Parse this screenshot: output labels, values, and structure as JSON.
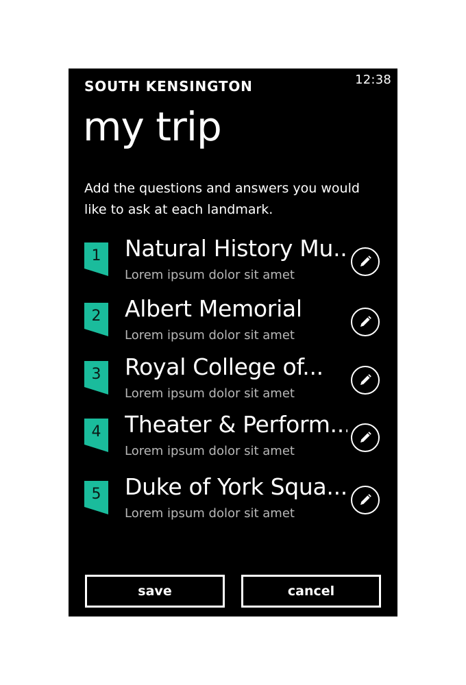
{
  "status_bar": {
    "time": "12:38"
  },
  "header": {
    "app_name": "SOUTH KENSINGTON",
    "page_title": "my trip"
  },
  "intro_text": "Add the questions and answers you would like to ask at each landmark.",
  "landmarks": [
    {
      "number": "1",
      "title": "Natural History Mu...",
      "subtitle": "Lorem ipsum dolor sit amet"
    },
    {
      "number": "2",
      "title": "Albert Memorial",
      "subtitle": "Lorem ipsum dolor sit amet"
    },
    {
      "number": "3",
      "title": "Royal College of...",
      "subtitle": "Lorem ipsum dolor sit amet"
    },
    {
      "number": "4",
      "title": "Theater & Perform...",
      "subtitle": "Lorem ipsum dolor sit amet"
    },
    {
      "number": "5",
      "title": "Duke of York Squa...",
      "subtitle": "Lorem ipsum dolor sit amet"
    }
  ],
  "edit_icon": "pencil-icon",
  "buttons": {
    "save_label": "save",
    "cancel_label": "cancel"
  },
  "colors": {
    "accent": "#1abc9c",
    "background": "#000000",
    "text": "#ffffff",
    "subtext": "#b8b8b8"
  }
}
